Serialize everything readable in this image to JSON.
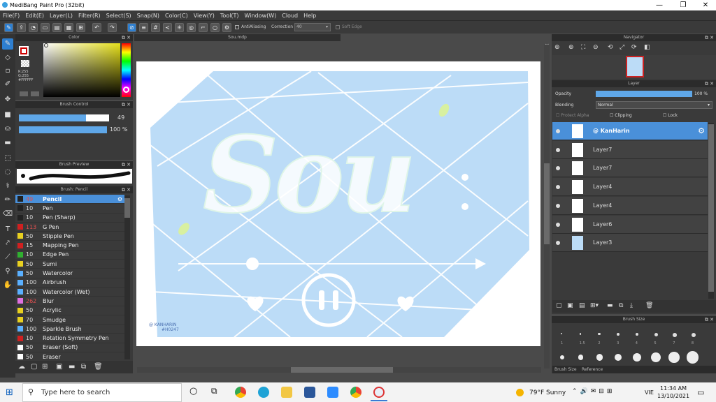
{
  "title": "MediBang Paint Pro (32bit)",
  "menu": [
    "File(F)",
    "Edit(E)",
    "Layer(L)",
    "Filter(R)",
    "Select(S)",
    "Snap(N)",
    "Color(C)",
    "View(Y)",
    "Tool(T)",
    "Window(W)",
    "Cloud",
    "Help"
  ],
  "toolbar": {
    "antialias_label": "AntiAliasing",
    "correction_label": "Correction",
    "correction_value": "40",
    "soft_edge_label": "Soft Edge"
  },
  "color_panel": {
    "title": "Color",
    "r": "R:255",
    "g": "G:255",
    "hex": "#FFFFFF"
  },
  "brush_control": {
    "title": "Brush Control",
    "size": "49",
    "opacity": "100 %"
  },
  "brush_preview": {
    "title": "Brush Preview"
  },
  "brush_list": {
    "title": "Brush: Pencil",
    "items": [
      {
        "size": "49",
        "name": "Pencil",
        "color": "#222222",
        "red": true
      },
      {
        "size": "10",
        "name": "Pen",
        "color": "#222222",
        "red": false
      },
      {
        "size": "10",
        "name": "Pen (Sharp)",
        "color": "#222222",
        "red": false
      },
      {
        "size": "113",
        "name": "G Pen",
        "color": "#d02020",
        "red": true
      },
      {
        "size": "50",
        "name": "Stipple Pen",
        "color": "#e8d020",
        "red": false
      },
      {
        "size": "15",
        "name": "Mapping Pen",
        "color": "#d02020",
        "red": false
      },
      {
        "size": "10",
        "name": "Edge Pen",
        "color": "#30b030",
        "red": false
      },
      {
        "size": "50",
        "name": "Sumi",
        "color": "#e8d020",
        "red": false
      },
      {
        "size": "50",
        "name": "Watercolor",
        "color": "#5ab0ff",
        "red": false
      },
      {
        "size": "100",
        "name": "Airbrush",
        "color": "#5ab0ff",
        "red": false
      },
      {
        "size": "100",
        "name": "Watercolor (Wet)",
        "color": "#5ab0ff",
        "red": false
      },
      {
        "size": "262",
        "name": "Blur",
        "color": "#e070e0",
        "red": true
      },
      {
        "size": "50",
        "name": "Acrylic",
        "color": "#e8d020",
        "red": false
      },
      {
        "size": "70",
        "name": "Smudge",
        "color": "#e8d020",
        "red": false
      },
      {
        "size": "100",
        "name": "Sparkle Brush",
        "color": "#5ab0ff",
        "red": false
      },
      {
        "size": "10",
        "name": "Rotation Symmetry Pen",
        "color": "#d02020",
        "red": false
      },
      {
        "size": "50",
        "name": "Eraser (Soft)",
        "color": "#ffffff",
        "red": false
      },
      {
        "size": "50",
        "name": "Eraser",
        "color": "#ffffff",
        "red": false
      }
    ]
  },
  "canvas": {
    "tab": "Sou.mdp",
    "art_text": "Sou",
    "signature": "@ KANHARIN",
    "signature2": "#H0247"
  },
  "navigator": {
    "title": "Navigator"
  },
  "layer_panel": {
    "title": "Layer",
    "opacity_label": "Opacity",
    "opacity_value": "100 %",
    "blending_label": "Blending",
    "blending_value": "Normal",
    "protect_alpha": "Protect Alpha",
    "clipping": "Clipping",
    "lock": "Lock",
    "layers": [
      "@ KanHarin",
      "Layer7",
      "Layer7",
      "Layer4",
      "Layer4",
      "Layer6",
      "Layer3"
    ]
  },
  "brush_size": {
    "title": "Brush Size",
    "numbers": [
      "1",
      "1.5",
      "2",
      "3",
      "4",
      "5",
      "7",
      "8"
    ],
    "tab1": "Brush Size",
    "tab2": "Reference"
  },
  "taskbar": {
    "search_placeholder": "Type here to search",
    "weather": "79°F Sunny",
    "lang": "VIE",
    "time": "11:34 AM",
    "date": "13/10/2021"
  }
}
